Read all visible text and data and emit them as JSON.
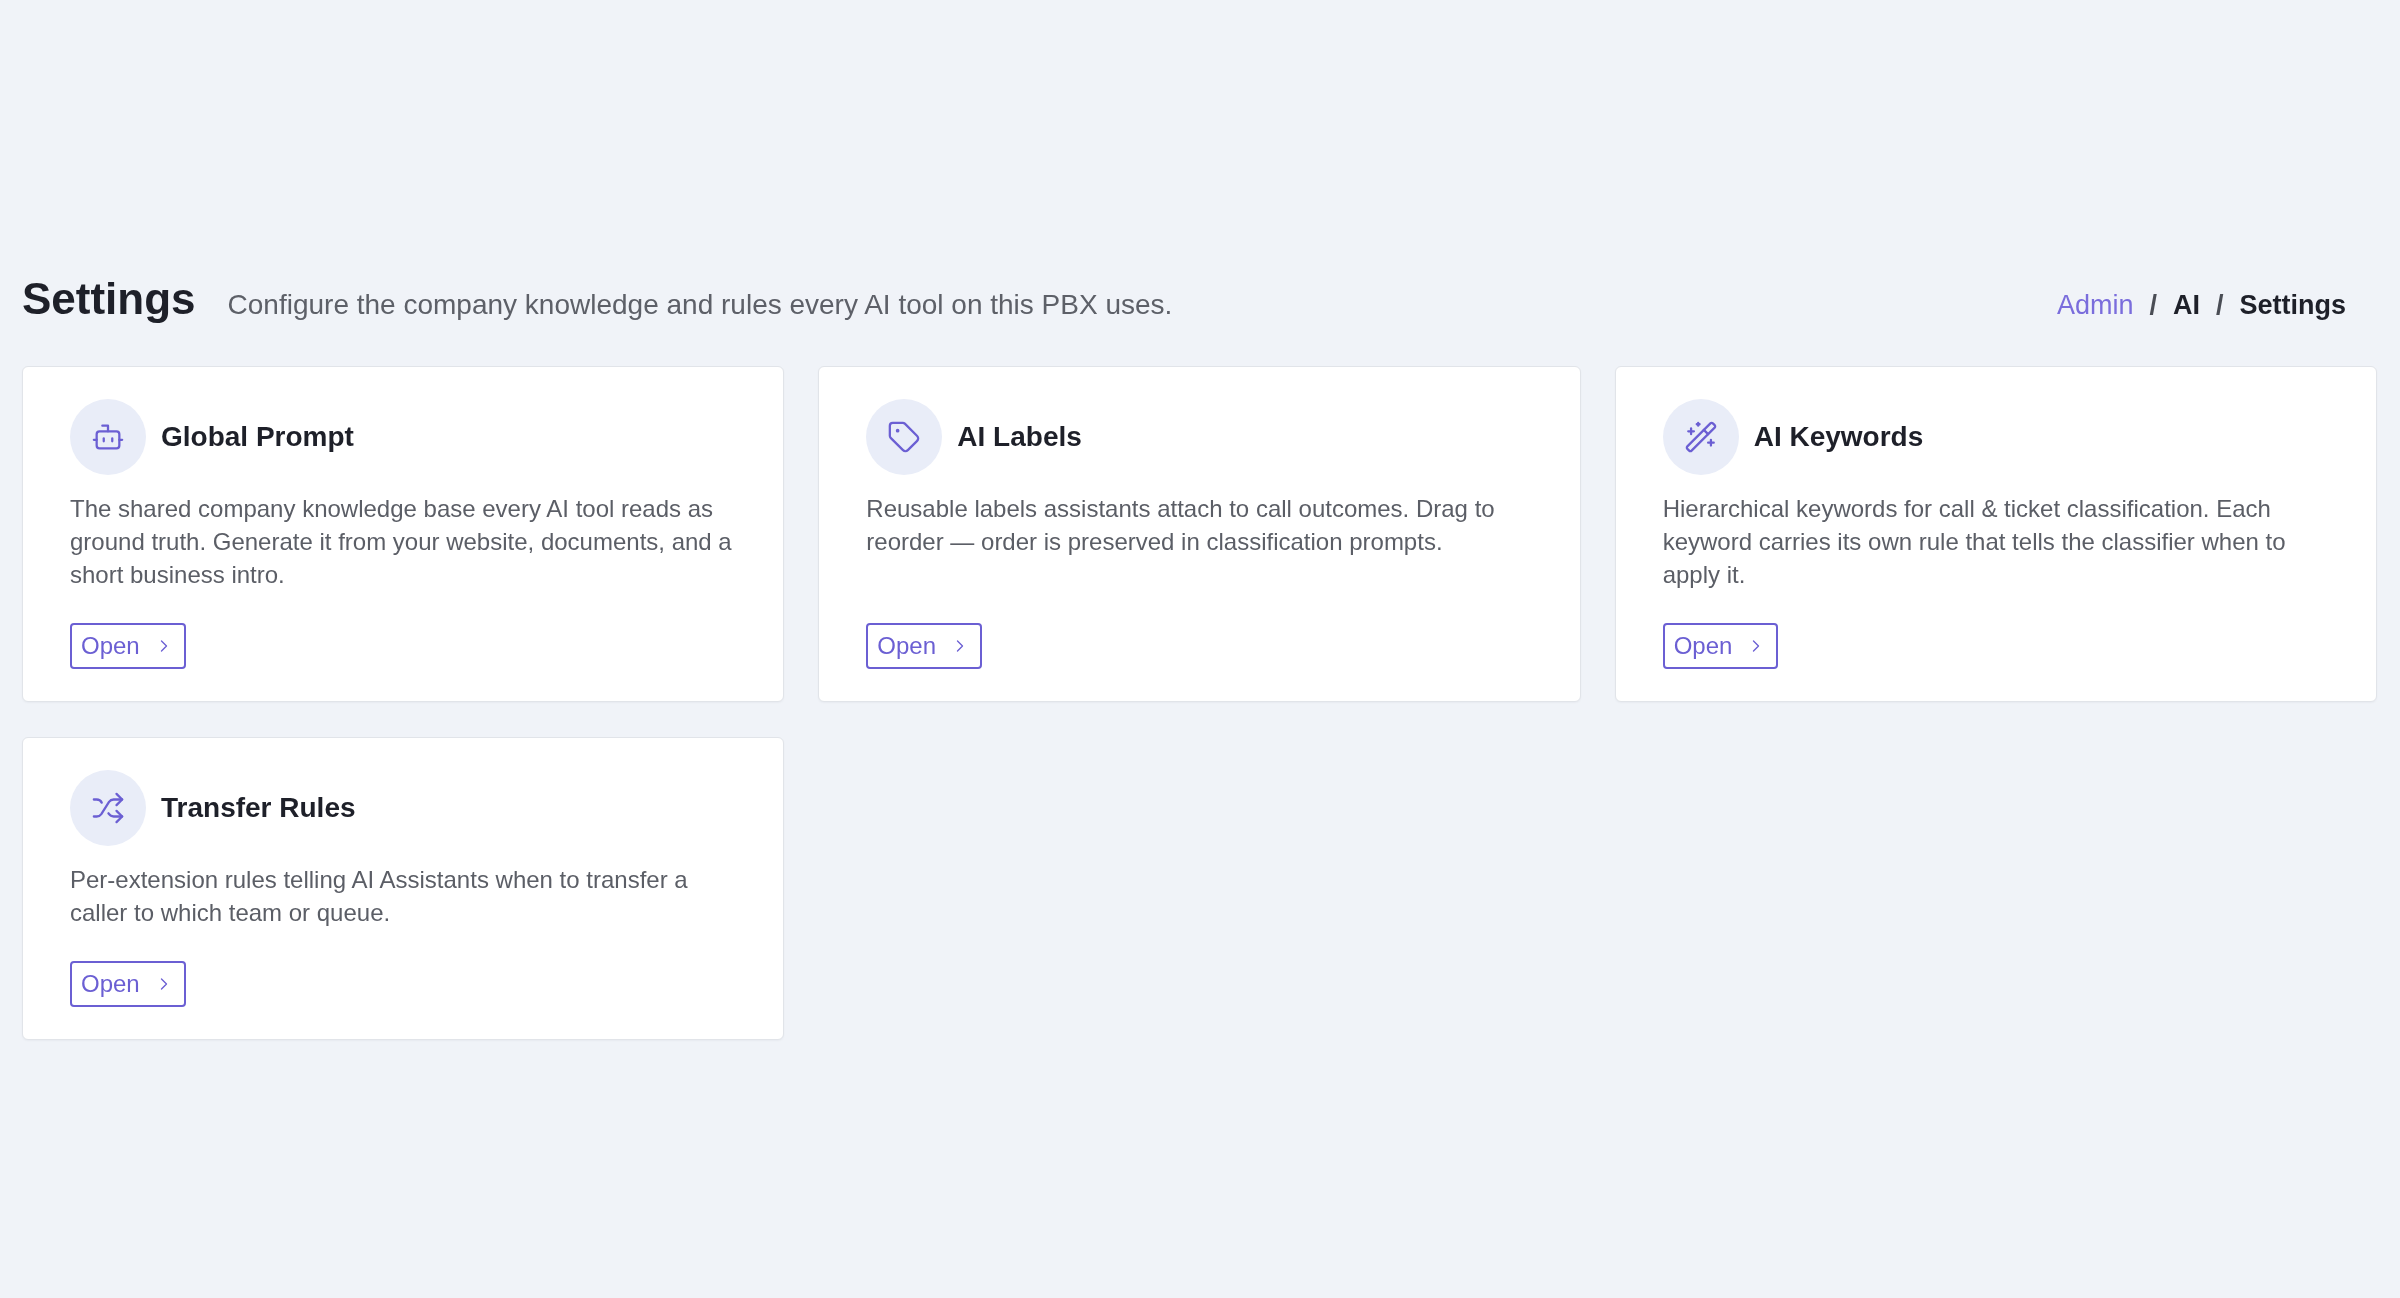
{
  "header": {
    "title": "Settings",
    "subtitle": "Configure the company knowledge and rules every AI tool on this PBX uses."
  },
  "breadcrumb": [
    {
      "kind": "link",
      "label": "Admin"
    },
    {
      "kind": "separator",
      "label": "/"
    },
    {
      "kind": "text",
      "label": "AI"
    },
    {
      "kind": "separator",
      "label": "/"
    },
    {
      "kind": "text",
      "label": "Settings"
    }
  ],
  "cards": [
    {
      "title": "Global Prompt",
      "description": "The shared company knowledge base every AI tool reads as ground truth. Generate it from your website, documents, and a short business intro.",
      "button": "Open"
    },
    {
      "title": "AI Labels",
      "description": "Reusable labels assistants attach to call outcomes. Drag to reorder — order is preserved in classification prompts.",
      "button": "Open"
    },
    {
      "title": "AI Keywords",
      "description": "Hierarchical keywords for call & ticket classification. Each keyword carries its own rule that tells the classifier when to apply it.",
      "button": "Open"
    },
    {
      "title": "Transfer Rules",
      "description": "Per-extension rules telling AI Assistants when to transfer a caller to which team or queue.",
      "button": "Open"
    }
  ]
}
